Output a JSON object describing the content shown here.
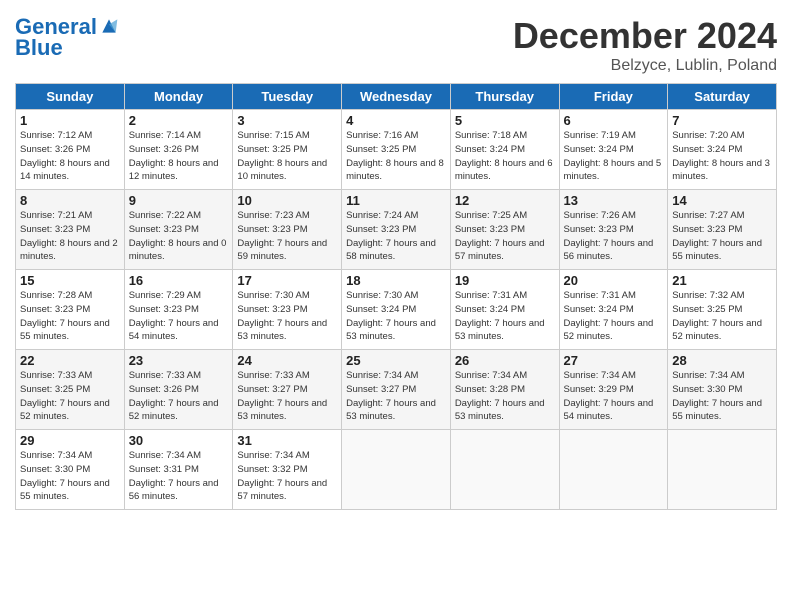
{
  "header": {
    "logo_line1": "General",
    "logo_line2": "Blue",
    "title": "December 2024",
    "subtitle": "Belzyce, Lublin, Poland"
  },
  "weekdays": [
    "Sunday",
    "Monday",
    "Tuesday",
    "Wednesday",
    "Thursday",
    "Friday",
    "Saturday"
  ],
  "weeks": [
    [
      {
        "day": "1",
        "sunrise": "7:12 AM",
        "sunset": "3:26 PM",
        "daylight": "8 hours and 14 minutes."
      },
      {
        "day": "2",
        "sunrise": "7:14 AM",
        "sunset": "3:26 PM",
        "daylight": "8 hours and 12 minutes."
      },
      {
        "day": "3",
        "sunrise": "7:15 AM",
        "sunset": "3:25 PM",
        "daylight": "8 hours and 10 minutes."
      },
      {
        "day": "4",
        "sunrise": "7:16 AM",
        "sunset": "3:25 PM",
        "daylight": "8 hours and 8 minutes."
      },
      {
        "day": "5",
        "sunrise": "7:18 AM",
        "sunset": "3:24 PM",
        "daylight": "8 hours and 6 minutes."
      },
      {
        "day": "6",
        "sunrise": "7:19 AM",
        "sunset": "3:24 PM",
        "daylight": "8 hours and 5 minutes."
      },
      {
        "day": "7",
        "sunrise": "7:20 AM",
        "sunset": "3:24 PM",
        "daylight": "8 hours and 3 minutes."
      }
    ],
    [
      {
        "day": "8",
        "sunrise": "7:21 AM",
        "sunset": "3:23 PM",
        "daylight": "8 hours and 2 minutes."
      },
      {
        "day": "9",
        "sunrise": "7:22 AM",
        "sunset": "3:23 PM",
        "daylight": "8 hours and 0 minutes."
      },
      {
        "day": "10",
        "sunrise": "7:23 AM",
        "sunset": "3:23 PM",
        "daylight": "7 hours and 59 minutes."
      },
      {
        "day": "11",
        "sunrise": "7:24 AM",
        "sunset": "3:23 PM",
        "daylight": "7 hours and 58 minutes."
      },
      {
        "day": "12",
        "sunrise": "7:25 AM",
        "sunset": "3:23 PM",
        "daylight": "7 hours and 57 minutes."
      },
      {
        "day": "13",
        "sunrise": "7:26 AM",
        "sunset": "3:23 PM",
        "daylight": "7 hours and 56 minutes."
      },
      {
        "day": "14",
        "sunrise": "7:27 AM",
        "sunset": "3:23 PM",
        "daylight": "7 hours and 55 minutes."
      }
    ],
    [
      {
        "day": "15",
        "sunrise": "7:28 AM",
        "sunset": "3:23 PM",
        "daylight": "7 hours and 55 minutes."
      },
      {
        "day": "16",
        "sunrise": "7:29 AM",
        "sunset": "3:23 PM",
        "daylight": "7 hours and 54 minutes."
      },
      {
        "day": "17",
        "sunrise": "7:30 AM",
        "sunset": "3:23 PM",
        "daylight": "7 hours and 53 minutes."
      },
      {
        "day": "18",
        "sunrise": "7:30 AM",
        "sunset": "3:24 PM",
        "daylight": "7 hours and 53 minutes."
      },
      {
        "day": "19",
        "sunrise": "7:31 AM",
        "sunset": "3:24 PM",
        "daylight": "7 hours and 53 minutes."
      },
      {
        "day": "20",
        "sunrise": "7:31 AM",
        "sunset": "3:24 PM",
        "daylight": "7 hours and 52 minutes."
      },
      {
        "day": "21",
        "sunrise": "7:32 AM",
        "sunset": "3:25 PM",
        "daylight": "7 hours and 52 minutes."
      }
    ],
    [
      {
        "day": "22",
        "sunrise": "7:33 AM",
        "sunset": "3:25 PM",
        "daylight": "7 hours and 52 minutes."
      },
      {
        "day": "23",
        "sunrise": "7:33 AM",
        "sunset": "3:26 PM",
        "daylight": "7 hours and 52 minutes."
      },
      {
        "day": "24",
        "sunrise": "7:33 AM",
        "sunset": "3:27 PM",
        "daylight": "7 hours and 53 minutes."
      },
      {
        "day": "25",
        "sunrise": "7:34 AM",
        "sunset": "3:27 PM",
        "daylight": "7 hours and 53 minutes."
      },
      {
        "day": "26",
        "sunrise": "7:34 AM",
        "sunset": "3:28 PM",
        "daylight": "7 hours and 53 minutes."
      },
      {
        "day": "27",
        "sunrise": "7:34 AM",
        "sunset": "3:29 PM",
        "daylight": "7 hours and 54 minutes."
      },
      {
        "day": "28",
        "sunrise": "7:34 AM",
        "sunset": "3:30 PM",
        "daylight": "7 hours and 55 minutes."
      }
    ],
    [
      {
        "day": "29",
        "sunrise": "7:34 AM",
        "sunset": "3:30 PM",
        "daylight": "7 hours and 55 minutes."
      },
      {
        "day": "30",
        "sunrise": "7:34 AM",
        "sunset": "3:31 PM",
        "daylight": "7 hours and 56 minutes."
      },
      {
        "day": "31",
        "sunrise": "7:34 AM",
        "sunset": "3:32 PM",
        "daylight": "7 hours and 57 minutes."
      },
      null,
      null,
      null,
      null
    ]
  ]
}
